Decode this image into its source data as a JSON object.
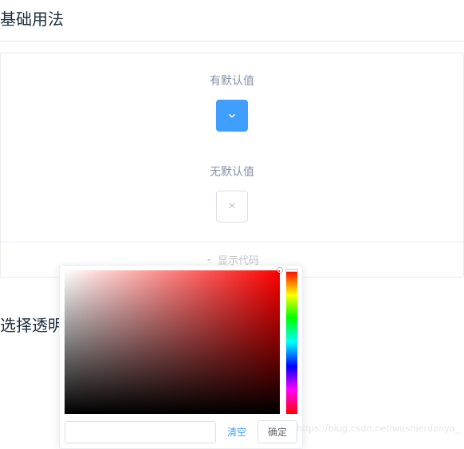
{
  "section1": {
    "title": "基础用法",
    "withDefault": {
      "label": "有默认值",
      "color": "#409EFF"
    },
    "noDefault": {
      "label": "无默认值"
    },
    "showCode": "显示代码"
  },
  "section2": {
    "title": "选择透明"
  },
  "picker": {
    "hexValue": "",
    "clear": "清空",
    "confirm": "确定"
  },
  "watermark": "https://blog.csdn.net/woshierdanya_"
}
